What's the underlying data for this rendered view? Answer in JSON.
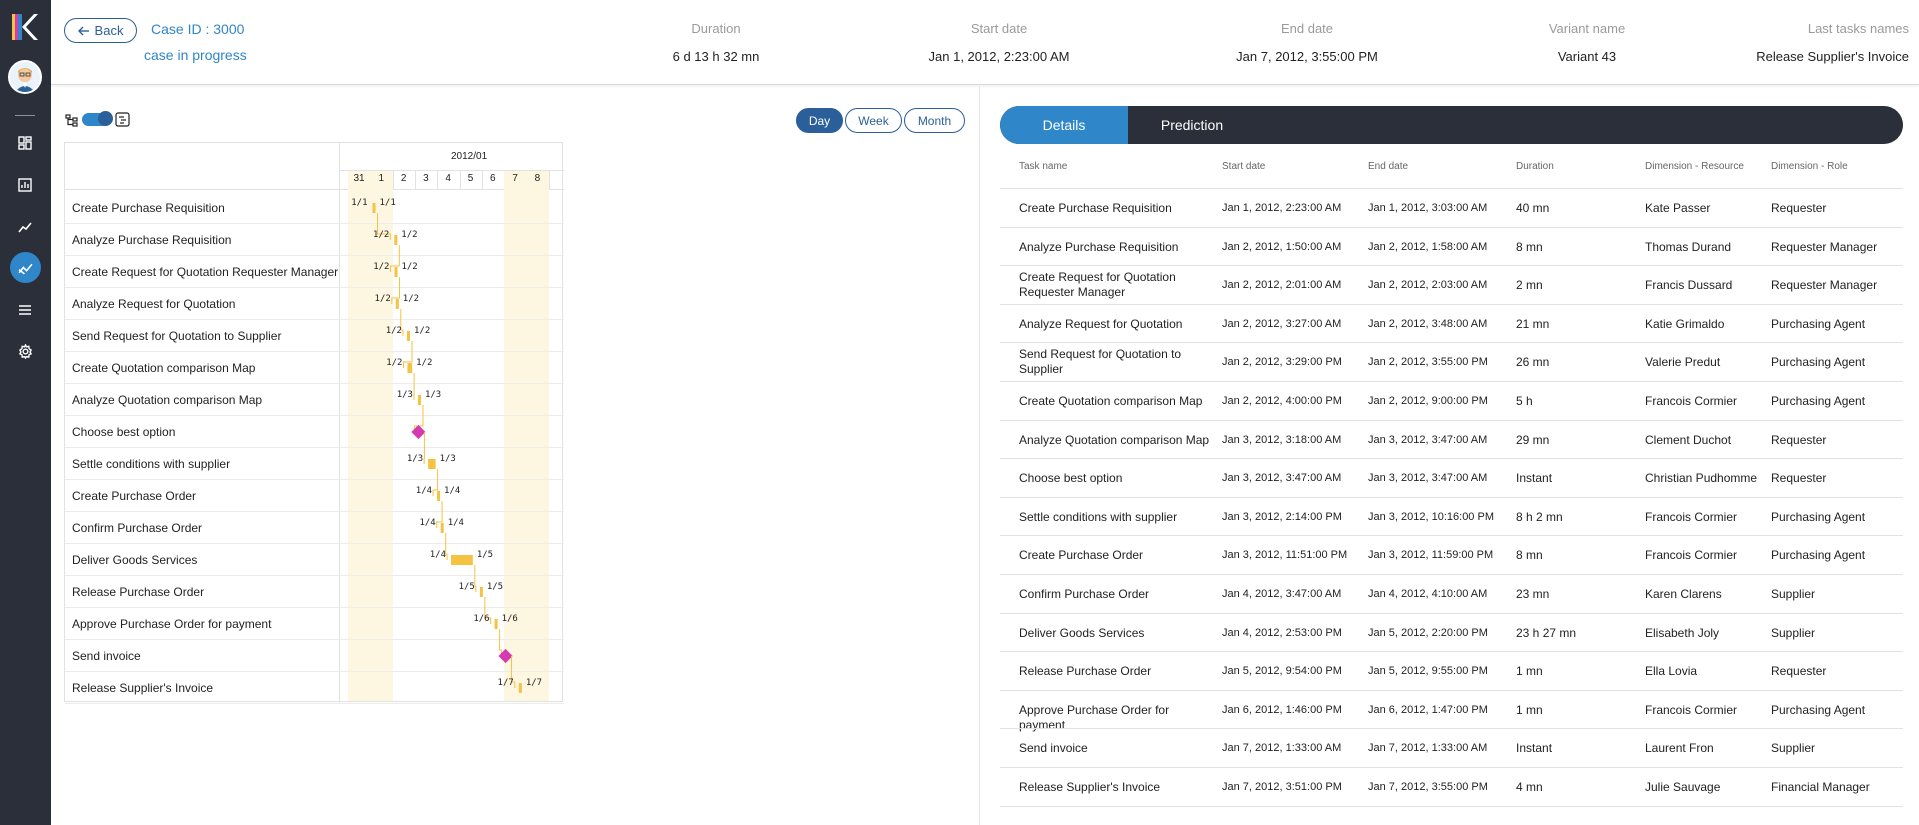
{
  "header": {
    "back_label": "Back",
    "case_id": "Case ID : 3000",
    "case_status": "case in progress",
    "columns": [
      {
        "label": "Duration",
        "value": "6 d 13 h 32 mn"
      },
      {
        "label": "Start date",
        "value": "Jan 1, 2012, 2:23:00 AM"
      },
      {
        "label": "End date",
        "value": "Jan 7, 2012, 3:55:00 PM"
      },
      {
        "label": "Variant name",
        "value": "Variant 43"
      },
      {
        "label": "Last tasks names",
        "value": "Release Supplier's Invoice"
      }
    ]
  },
  "sidebar": {
    "items": [
      {
        "icon": "dashboard-icon"
      },
      {
        "icon": "bar-chart-icon"
      },
      {
        "icon": "line-chart-icon"
      },
      {
        "icon": "process-analysis-icon",
        "active": true
      },
      {
        "icon": "list-icon"
      },
      {
        "icon": "settings-icon"
      }
    ]
  },
  "gantt": {
    "scale_buttons": [
      "Day",
      "Week",
      "Month"
    ],
    "active_scale": "Day",
    "month": "2012/01",
    "days": [
      "31",
      "1",
      "2",
      "3",
      "4",
      "5",
      "6",
      "7",
      "8"
    ],
    "tasks": [
      {
        "name": "Create Purchase Requisition",
        "start": "1/1",
        "end": "1/1"
      },
      {
        "name": "Analyze Purchase Requisition",
        "start": "1/2",
        "end": "1/2"
      },
      {
        "name": "Create Request for Quotation Requester Manager",
        "start": "1/2",
        "end": "1/2"
      },
      {
        "name": "Analyze Request for Quotation",
        "start": "1/2",
        "end": "1/2"
      },
      {
        "name": "Send Request for Quotation to Supplier",
        "start": "1/2",
        "end": "1/2"
      },
      {
        "name": "Create Quotation comparison Map",
        "start": "1/2",
        "end": "1/2"
      },
      {
        "name": "Analyze Quotation comparison Map",
        "start": "1/3",
        "end": "1/3"
      },
      {
        "name": "Choose best option",
        "start": "",
        "end": ""
      },
      {
        "name": "Settle conditions with supplier",
        "start": "1/3",
        "end": "1/3"
      },
      {
        "name": "Create Purchase Order",
        "start": "1/4",
        "end": "1/4"
      },
      {
        "name": "Confirm Purchase Order",
        "start": "1/4",
        "end": "1/4"
      },
      {
        "name": "Deliver Goods Services",
        "start": "1/4",
        "end": "1/5"
      },
      {
        "name": "Release Purchase Order",
        "start": "1/5",
        "end": "1/5"
      },
      {
        "name": "Approve Purchase Order for payment",
        "start": "1/6",
        "end": "1/6"
      },
      {
        "name": "Send invoice",
        "start": "",
        "end": ""
      },
      {
        "name": "Release Supplier's Invoice",
        "start": "1/7",
        "end": "1/7"
      }
    ]
  },
  "details": {
    "tabs": [
      "Details",
      "Prediction"
    ],
    "columns": [
      "Task name",
      "Start date",
      "End date",
      "Duration",
      "Dimension - Resource",
      "Dimension - Role"
    ],
    "rows": [
      [
        "Create Purchase Requisition",
        "Jan 1, 2012, 2:23:00 AM",
        "Jan 1, 2012, 3:03:00 AM",
        "40 mn",
        "Kate Passer",
        "Requester"
      ],
      [
        "Analyze Purchase Requisition",
        "Jan 2, 2012, 1:50:00 AM",
        "Jan 2, 2012, 1:58:00 AM",
        "8 mn",
        "Thomas Durand",
        "Requester Manager"
      ],
      [
        "Create Request for Quotation Requester Manager",
        "Jan 2, 2012, 2:01:00 AM",
        "Jan 2, 2012, 2:03:00 AM",
        "2 mn",
        "Francis Dussard",
        "Requester Manager"
      ],
      [
        "Analyze Request for Quotation",
        "Jan 2, 2012, 3:27:00 AM",
        "Jan 2, 2012, 3:48:00 AM",
        "21 mn",
        "Katie Grimaldo",
        "Purchasing Agent"
      ],
      [
        "Send Request for Quotation to Supplier",
        "Jan 2, 2012, 3:29:00 PM",
        "Jan 2, 2012, 3:55:00 PM",
        "26 mn",
        "Valerie Predut",
        "Purchasing Agent"
      ],
      [
        "Create Quotation comparison Map",
        "Jan 2, 2012, 4:00:00 PM",
        "Jan 2, 2012, 9:00:00 PM",
        "5 h",
        "Francois Cormier",
        "Purchasing Agent"
      ],
      [
        "Analyze Quotation comparison Map",
        "Jan 3, 2012, 3:18:00 AM",
        "Jan 3, 2012, 3:47:00 AM",
        "29 mn",
        "Clement Duchot",
        "Requester"
      ],
      [
        "Choose best option",
        "Jan 3, 2012, 3:47:00 AM",
        "Jan 3, 2012, 3:47:00 AM",
        "Instant",
        "Christian Pudhomme",
        "Requester"
      ],
      [
        "Settle conditions with supplier",
        "Jan 3, 2012, 2:14:00 PM",
        "Jan 3, 2012, 10:16:00 PM",
        "8 h 2 mn",
        "Francois Cormier",
        "Purchasing Agent"
      ],
      [
        "Create Purchase Order",
        "Jan 3, 2012, 11:51:00 PM",
        "Jan 3, 2012, 11:59:00 PM",
        "8 mn",
        "Francois Cormier",
        "Purchasing Agent"
      ],
      [
        "Confirm Purchase Order",
        "Jan 4, 2012, 3:47:00 AM",
        "Jan 4, 2012, 4:10:00 AM",
        "23 mn",
        "Karen Clarens",
        "Supplier"
      ],
      [
        "Deliver Goods Services",
        "Jan 4, 2012, 2:53:00 PM",
        "Jan 5, 2012, 2:20:00 PM",
        "23 h 27 mn",
        "Elisabeth Joly",
        "Supplier"
      ],
      [
        "Release Purchase Order",
        "Jan 5, 2012, 9:54:00 PM",
        "Jan 5, 2012, 9:55:00 PM",
        "1 mn",
        "Ella Lovia",
        "Requester"
      ],
      [
        "Approve Purchase Order for payment",
        "Jan 6, 2012, 1:46:00 PM",
        "Jan 6, 2012, 1:47:00 PM",
        "1 mn",
        "Francois Cormier",
        "Purchasing Agent"
      ],
      [
        "Send invoice",
        "Jan 7, 2012, 1:33:00 AM",
        "Jan 7, 2012, 1:33:00 AM",
        "Instant",
        "Laurent Fron",
        "Supplier"
      ],
      [
        "Release Supplier's Invoice",
        "Jan 7, 2012, 3:51:00 PM",
        "Jan 7, 2012, 3:55:00 PM",
        "4 mn",
        "Julie Sauvage",
        "Financial Manager"
      ]
    ]
  },
  "colors": {
    "sidebar": "#2a2f3a",
    "accent": "#2f86c9",
    "accent_dark": "#2b5f9a",
    "task_bar": "#f5c242",
    "milestone": "#d63ab0",
    "weekend": "#fdf6e0"
  }
}
